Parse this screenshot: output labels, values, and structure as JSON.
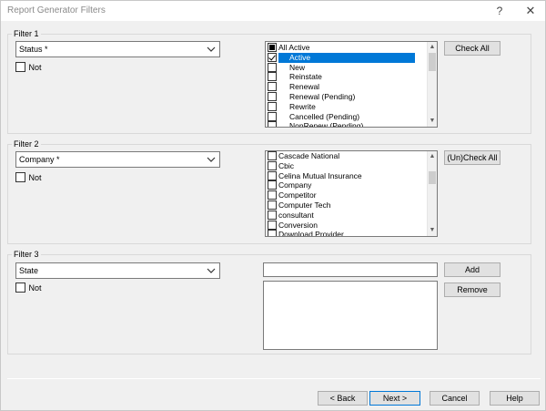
{
  "window": {
    "title": "Report Generator Filters",
    "help_glyph": "?",
    "close_glyph": "✕"
  },
  "filter1": {
    "group_label": "Filter 1",
    "combo_value": "Status *",
    "not_label": "Not",
    "check_all_label": "Check All",
    "items": [
      {
        "label": "All Active",
        "state": "filled"
      },
      {
        "label": "Active",
        "state": "checked",
        "selected": true
      },
      {
        "label": "New",
        "state": "unchecked"
      },
      {
        "label": "Reinstate",
        "state": "unchecked"
      },
      {
        "label": "Renewal",
        "state": "unchecked"
      },
      {
        "label": "Renewal (Pending)",
        "state": "unchecked"
      },
      {
        "label": "Rewrite",
        "state": "unchecked"
      },
      {
        "label": "Cancelled (Pending)",
        "state": "unchecked"
      },
      {
        "label": "NonRenew (Pending)",
        "state": "unchecked"
      }
    ]
  },
  "filter2": {
    "group_label": "Filter 2",
    "combo_value": "Company *",
    "not_label": "Not",
    "uncheck_all_label": "(Un)Check All",
    "items": [
      {
        "label": "Cascade National"
      },
      {
        "label": "Cbic"
      },
      {
        "label": "Celina Mutual Insurance"
      },
      {
        "label": "Company"
      },
      {
        "label": "Competitor"
      },
      {
        "label": "Computer Tech"
      },
      {
        "label": "consultant"
      },
      {
        "label": "Conversion"
      },
      {
        "label": "Download Provider"
      }
    ]
  },
  "filter3": {
    "group_label": "Filter 3",
    "combo_value": "State",
    "not_label": "Not",
    "input_value": "",
    "add_label": "Add",
    "remove_label": "Remove"
  },
  "footer": {
    "back_label": "< Back",
    "next_label": "Next >",
    "cancel_label": "Cancel",
    "help_label": "Help"
  },
  "colors": {
    "selection": "#0078d7",
    "dialog_bg": "#f0f0f0"
  }
}
